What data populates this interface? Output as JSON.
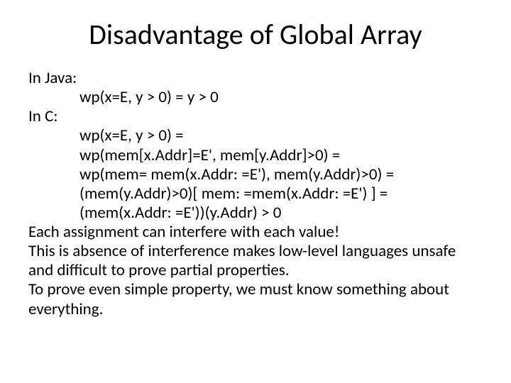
{
  "title": "Disadvantage of Global Array",
  "lines": {
    "l0": "In Java:",
    "l1": "wp(x=E, y > 0) = y > 0",
    "l2": "In C:",
    "l3": "wp(x=E, y > 0) =",
    "l4": "wp(mem[x.Addr]=E',  mem[y.Addr]>0) =",
    "l5": "wp(mem= mem(x.Addr: =E'), mem(y.Addr)>0) =",
    "l6": "(mem(y.Addr)>0)[ mem: =mem(x.Addr: =E') ] =",
    "l7": "(mem(x.Addr: =E'))(y.Addr) > 0",
    "l8": "Each assignment can interfere with each value!",
    "l9": "This is absence of interference makes low-level languages unsafe and difficult to prove partial properties.",
    "l10": "To prove even simple property, we must know something about everything."
  }
}
